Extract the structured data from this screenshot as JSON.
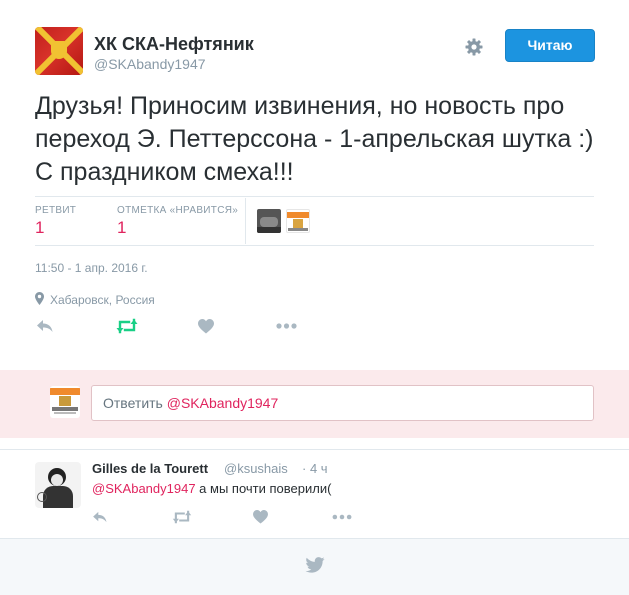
{
  "tweet": {
    "display_name": "ХК СКА-Нефтяник",
    "handle": "@SKAbandy1947",
    "follow_label": "Читаю",
    "text": "Друзья! Приносим извинения, но новость про переход Э. Петтерссона - 1-апрельская шутка :) С праздником смеха!!!",
    "stats": {
      "retweets_label": "РЕТВИТ",
      "retweets_value": "1",
      "likes_label": "ОТМЕТКА «НРАВИТСЯ»",
      "likes_value": "1"
    },
    "timestamp": "11:50 - 1 апр. 2016 г.",
    "location": "Хабаровск, Россия"
  },
  "reply_box": {
    "prefix": "Ответить",
    "mention": "@SKAbandy1947"
  },
  "reply": {
    "display_name": "Gilles de la Tourett",
    "handle": "@ksushais",
    "separator": "·",
    "time": "4 ч",
    "mention": "@SKAbandy1947",
    "text": " а мы почти поверили("
  },
  "icons": {
    "settings": "gear-icon",
    "reply": "reply-icon",
    "retweet": "retweet-icon",
    "like": "heart-icon",
    "more": "more-icon",
    "location": "location-pin-icon",
    "footer": "twitter-bird-icon"
  },
  "colors": {
    "accent": "#1c94e0",
    "mention": "#e0245e",
    "retweet_active": "#19cf86",
    "muted": "#8899a6",
    "reply_band": "#fbeaec"
  }
}
